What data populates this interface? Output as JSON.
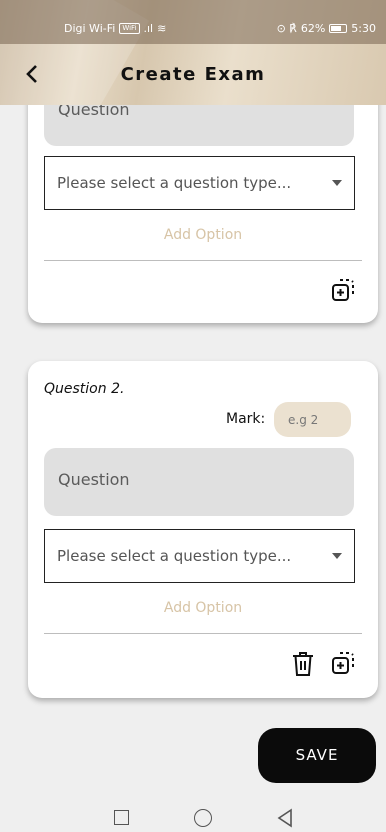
{
  "status_bar": {
    "carrier": "Digi Wi-Fi",
    "wifi_badge": "WiFi",
    "signal": ".ıl",
    "right_icons": "⊙ ℟",
    "battery": "62%",
    "time": "5:30"
  },
  "header": {
    "title": "Create Exam",
    "back_icon": "chevron-left-icon"
  },
  "question_1": {
    "question_placeholder": "Question",
    "type_select": "Please select a question type...",
    "add_option": "Add Option",
    "actions": [
      "add-copy-icon"
    ]
  },
  "question_2": {
    "label": "Question 2.",
    "mark_label": "Mark:",
    "mark_placeholder": "e.g 2",
    "question_placeholder": "Question",
    "type_select": "Please select a question type...",
    "add_option": "Add Option",
    "actions": [
      "trash-icon",
      "add-copy-icon"
    ]
  },
  "save_label": "SAVE",
  "colors": {
    "header_bg": "#e3d6c0",
    "accent_beige": "#d7c4a6",
    "mark_bg": "#ebe1d0",
    "save_bg": "#0b0b0b"
  }
}
